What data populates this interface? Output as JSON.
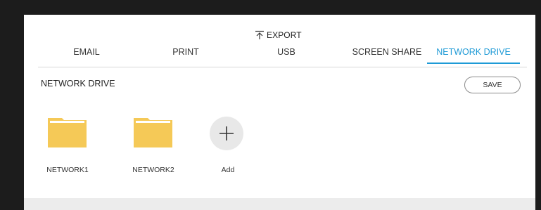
{
  "export": {
    "title": "EXPORT"
  },
  "tabs": [
    {
      "label": "EMAIL"
    },
    {
      "label": "PRINT"
    },
    {
      "label": "USB"
    },
    {
      "label": "SCREEN SHARE"
    },
    {
      "label": "NETWORK DRIVE",
      "active": true
    }
  ],
  "section": {
    "title": "NETWORK DRIVE",
    "save_label": "SAVE"
  },
  "items": [
    {
      "label": "NETWORK1",
      "icon": "folder-icon"
    },
    {
      "label": "NETWORK2",
      "icon": "folder-icon"
    },
    {
      "label": "Add",
      "icon": "plus-icon"
    }
  ],
  "colors": {
    "accent": "#1e9ad6",
    "folder": "#f5c957",
    "background": "#1c1c1c",
    "panel": "#ffffff"
  }
}
